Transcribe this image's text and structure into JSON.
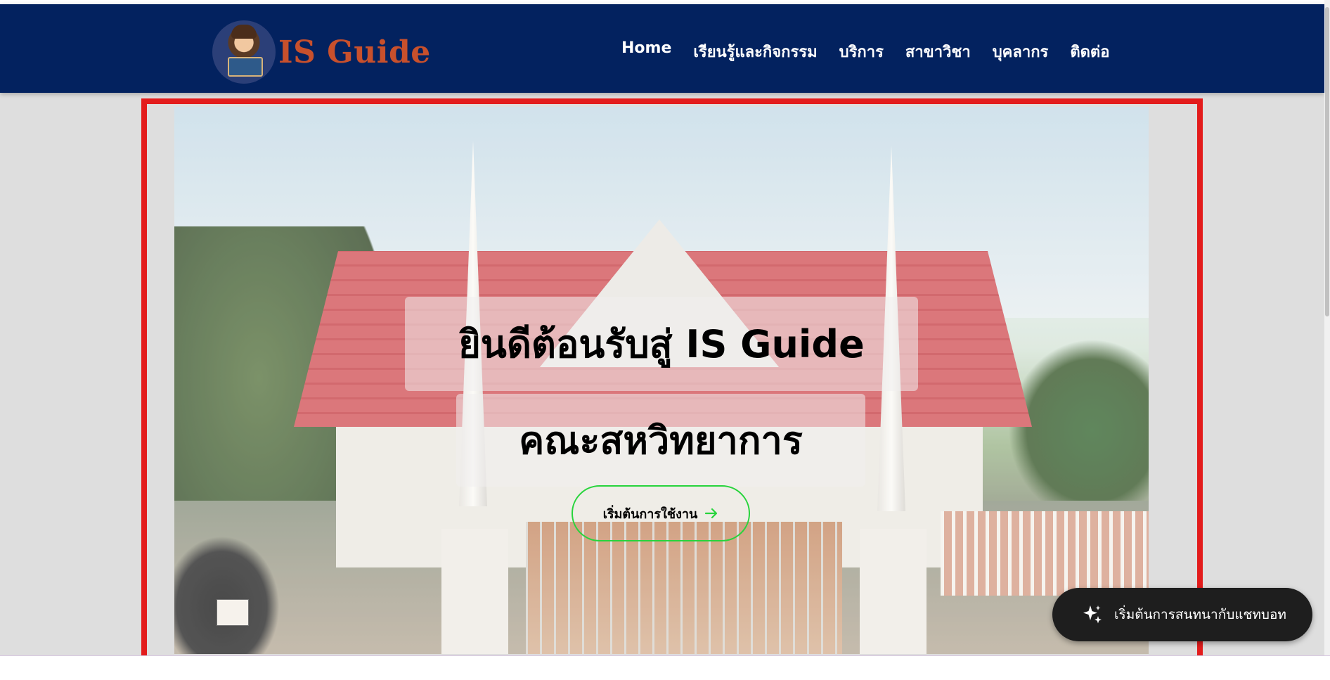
{
  "navbar": {
    "logo_text": "IS Guide",
    "links": [
      {
        "label": "Home"
      },
      {
        "label": "เรียนรู้และกิจกรรม"
      },
      {
        "label": "บริการ"
      },
      {
        "label": "สาขาวิชา"
      },
      {
        "label": "บุคลากร"
      },
      {
        "label": "ติดต่อ"
      }
    ]
  },
  "hero": {
    "title": "ยินดีต้อนรับสู่ IS Guide",
    "subtitle": "คณะสหวิทยาการ",
    "start_button_label": "เริ่มต้นการใช้งาน"
  },
  "chatbot": {
    "label": "เริ่มต้นการสนทนากับแชทบอท"
  },
  "colors": {
    "navbar_bg": "#03225f",
    "logo_text": "#c8502c",
    "start_button_border": "#27d43c",
    "highlight_border": "#e31c1c",
    "chat_button_bg": "#1e1e1e"
  },
  "icons": {
    "logo": "student-reading-avatar",
    "start_arrow": "arrow-right-icon",
    "chat": "sparkle-icon"
  }
}
